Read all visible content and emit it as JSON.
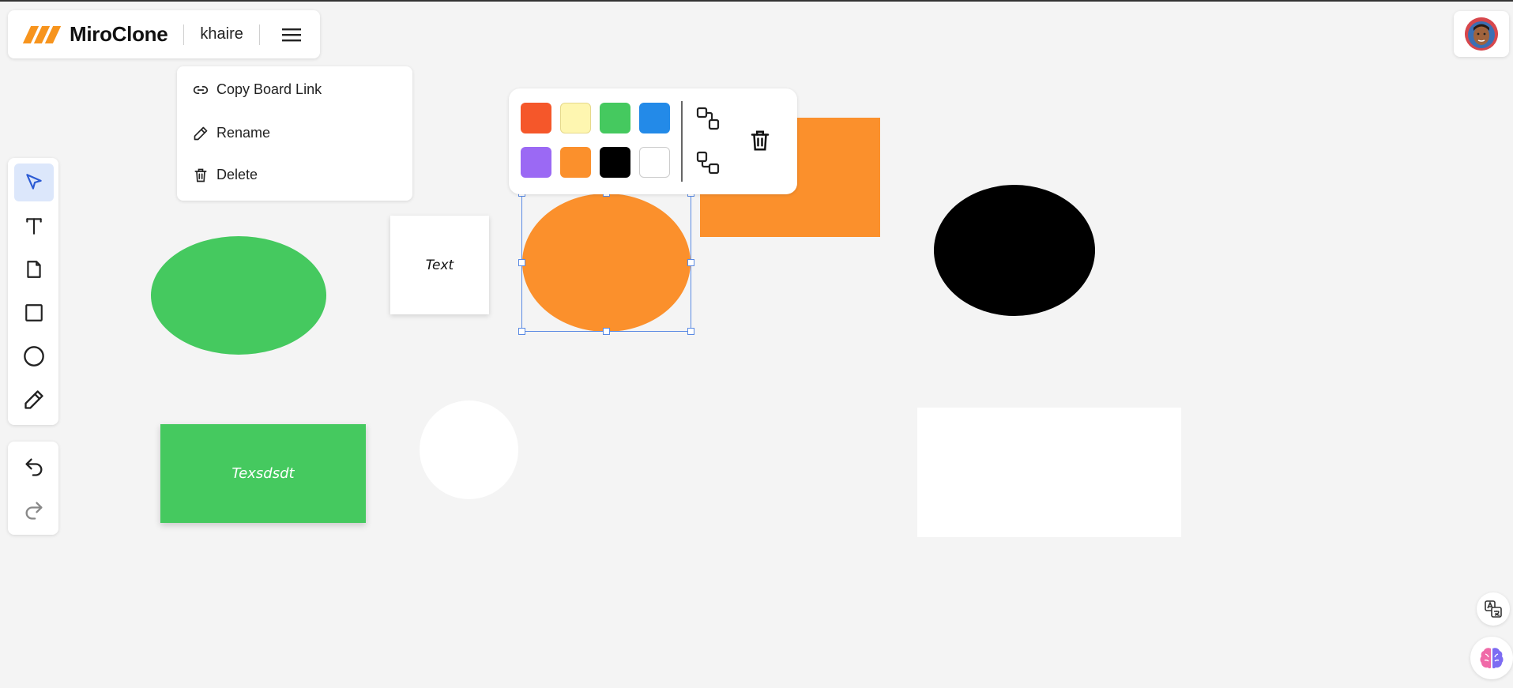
{
  "header": {
    "app_name": "MiroClone",
    "board_name": "khaire"
  },
  "board_menu": {
    "items": [
      {
        "label": "Copy Board Link",
        "icon": "link-icon"
      },
      {
        "label": "Rename",
        "icon": "pencil-icon"
      },
      {
        "label": "Delete",
        "icon": "trash-icon"
      }
    ]
  },
  "toolbar": {
    "tools": [
      "select-icon",
      "text-icon",
      "sticky-note-icon",
      "rectangle-icon",
      "ellipse-icon",
      "pencil-icon"
    ],
    "active": "select",
    "history": [
      "undo-icon",
      "redo-icon"
    ]
  },
  "palette": {
    "colors": [
      "#f5572a",
      "#fef6b0",
      "#45c95f",
      "#238ae8",
      "#9b69f4",
      "#fb902c",
      "#000000",
      "#ffffff"
    ],
    "actions": [
      "bring-to-front-icon",
      "send-to-back-icon",
      "delete-icon"
    ]
  },
  "canvas": {
    "text_note_label": "Text",
    "green_rect_label": "Texsdsdt"
  },
  "colors": {
    "orange": "#fb902c",
    "green": "#45c95f",
    "black": "#000000",
    "white": "#ffffff",
    "selection": "#5a8ae3",
    "brand": "#f7941d"
  }
}
